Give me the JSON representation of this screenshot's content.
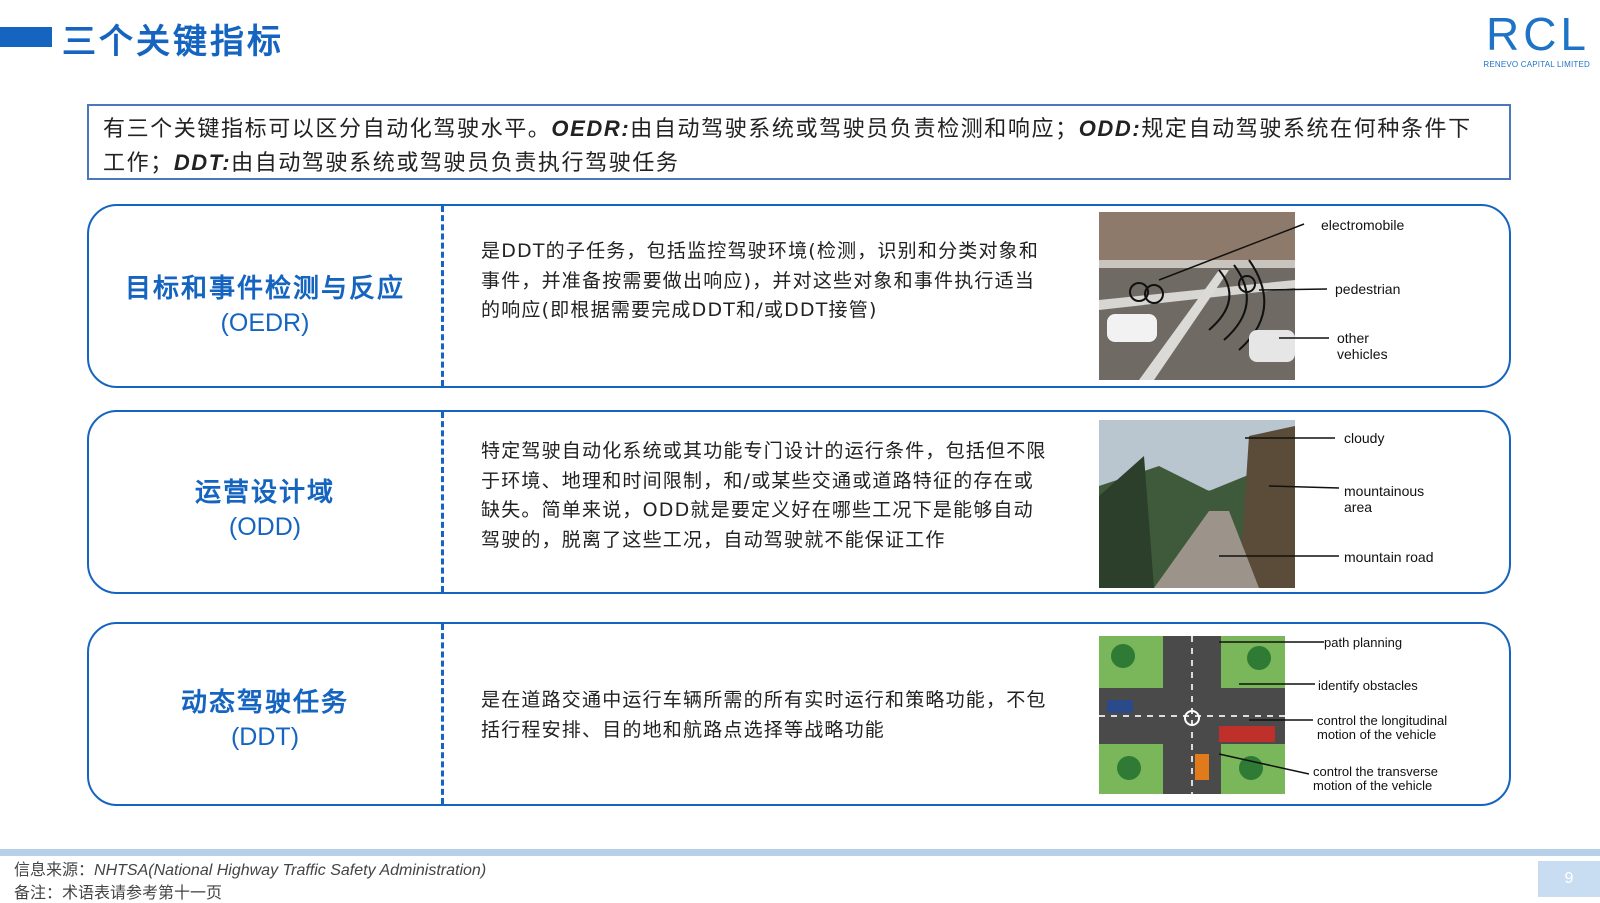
{
  "header": {
    "title": "三个关键指标",
    "logo_text": "RCL",
    "logo_subtitle": "RENEVO CAPITAL LIMITED"
  },
  "intro": {
    "part1": "有三个关键指标可以区分自动化驾驶水平。",
    "term1": "OEDR:",
    "part2": "由自动驾驶系统或驾驶员负责检测和响应；",
    "term2": "ODD:",
    "part3": "规定自动驾驶系统在何种条件下工作；",
    "term3": "DDT:",
    "part4": "由自动驾驶系统或驾驶员负责执行驾驶任务"
  },
  "metrics": [
    {
      "name": "目标和事件检测与反应",
      "abbr": "(OEDR)",
      "description": "是DDT的子任务，包括监控驾驶环境(检测，识别和分类对象和事件，并准备按需要做出响应)，并对这些对象和事件执行适当的响应(即根据需要完成DDT和/或DDT接管)",
      "figure_labels": [
        "electromobile",
        "pedestrian",
        "other",
        "vehicles"
      ]
    },
    {
      "name": "运营设计域",
      "abbr": "(ODD)",
      "description": "特定驾驶自动化系统或其功能专门设计的运行条件，包括但不限于环境、地理和时间限制，和/或某些交通或道路特征的存在或缺失。简单来说，ODD就是要定义好在哪些工况下是能够自动驾驶的，脱离了这些工况，自动驾驶就不能保证工作",
      "figure_labels": [
        "cloudy",
        "mountainous",
        "area",
        "mountain road"
      ]
    },
    {
      "name": "动态驾驶任务",
      "abbr": "(DDT)",
      "description": "是在道路交通中运行车辆所需的所有实时运行和策略功能，不包括行程安排、目的地和航路点选择等战略功能",
      "figure_labels": [
        "path planning",
        "identify obstacles",
        "control the longitudinal",
        "motion of the vehicle",
        "control the transverse",
        "motion of the vehicle"
      ]
    }
  ],
  "footer": {
    "source_label": "信息来源：",
    "source_text": "NHTSA(National Highway Traffic Safety Administration)",
    "note": "备注：术语表请参考第十一页",
    "page_number": "9"
  }
}
